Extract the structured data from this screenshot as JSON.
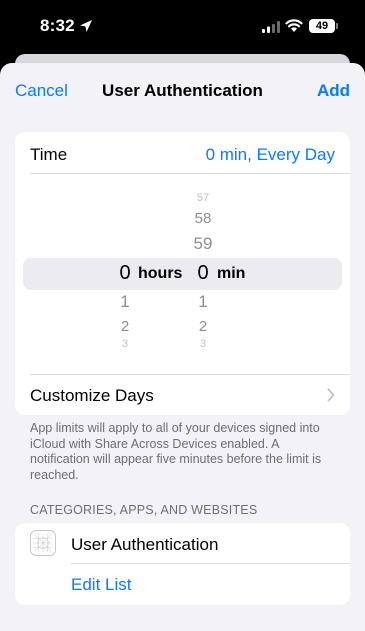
{
  "status_bar": {
    "time": "8:32",
    "battery": "49"
  },
  "nav": {
    "cancel": "Cancel",
    "title": "User Authentication",
    "add": "Add"
  },
  "time_row": {
    "label": "Time",
    "value": "0 min, Every Day"
  },
  "picker": {
    "hours_above": [
      "",
      "",
      ""
    ],
    "hours_selected": "0",
    "hours_unit": "hours",
    "hours_below": [
      "1",
      "2",
      "3"
    ],
    "minutes_above": [
      "57",
      "58",
      "59"
    ],
    "minutes_selected": "0",
    "minutes_unit": "min",
    "minutes_below": [
      "1",
      "2",
      "3"
    ]
  },
  "customize_days": {
    "label": "Customize Days"
  },
  "footnote": "App limits will apply to all of your devices signed into iCloud with Share Across Devices enabled. A notification will appear five minutes before the limit is reached.",
  "section_header": "CATEGORIES, APPS, AND WEBSITES",
  "apps": {
    "item_name": "User Authentication",
    "edit_list": "Edit List"
  },
  "colors": {
    "accent": "#0a7aff",
    "background": "#f2f2f7",
    "secondary_text": "#6d6d72"
  },
  "icons": [
    "location-arrow-icon",
    "cellular-signal-icon",
    "wifi-icon",
    "battery-icon",
    "chevron-right-icon",
    "app-placeholder-icon"
  ]
}
